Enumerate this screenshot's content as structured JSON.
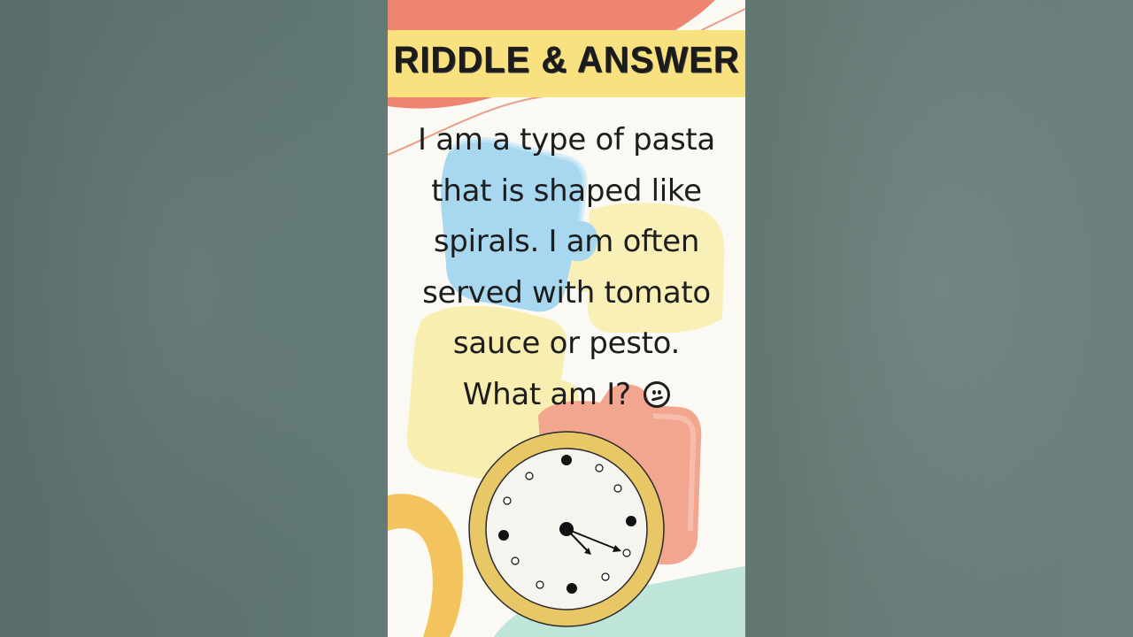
{
  "banner": {
    "title": "RIDDLE & ANSWER"
  },
  "riddle": {
    "lines": [
      "I am a type of pasta",
      "that is shaped like",
      "spirals. I am often",
      "served with tomato",
      "sauce or pesto.",
      "What am I?"
    ]
  },
  "icons": {
    "thinking_face": "confused-face-icon",
    "clock": "clock-icon"
  },
  "colors": {
    "banner": "#f8e17e",
    "coral_blob": "#ee8570",
    "clock_rim": "#e8c766",
    "puzzle_blue": "#a8d8f0",
    "puzzle_yellow": "#f7eeb0",
    "puzzle_pink": "#f2a58f",
    "mint_blob": "#bfe4da"
  }
}
